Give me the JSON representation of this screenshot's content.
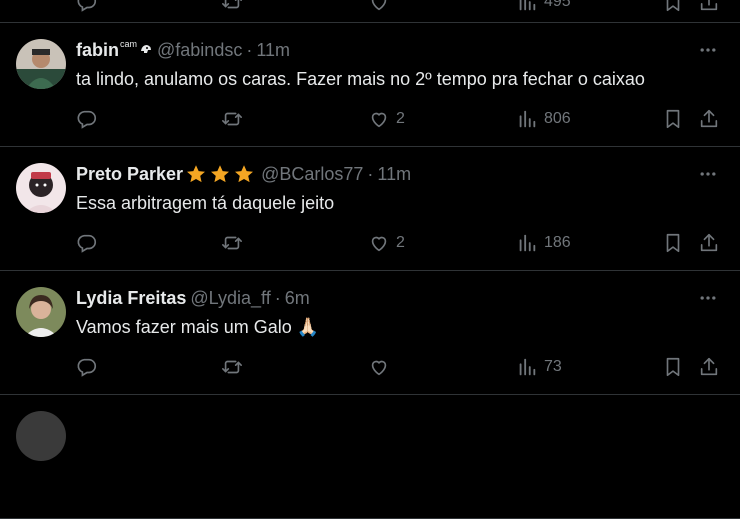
{
  "top_partial": {
    "views_count": "495"
  },
  "tweets": [
    {
      "name": "fabin",
      "badge": "cam",
      "handle": "@fabindsc",
      "dot": "·",
      "time": "11m",
      "text": "ta lindo, anulamo os caras. Fazer mais no 2º tempo pra fechar o caixao",
      "reply_count": "",
      "retweet_count": "",
      "like_count": "2",
      "view_count": "806"
    },
    {
      "name": "Preto Parker",
      "handle": "@BCarlos77",
      "dot": "·",
      "time": "11m",
      "text": "Essa arbitragem tá daquele jeito",
      "reply_count": "",
      "retweet_count": "",
      "like_count": "2",
      "view_count": "186"
    },
    {
      "name": "Lydia Freitas",
      "handle": "@Lydia_ff",
      "dot": "·",
      "time": "6m",
      "text": "Vamos fazer mais um Galo",
      "emoji": "🙏🏻",
      "reply_count": "",
      "retweet_count": "",
      "like_count": "",
      "view_count": "73"
    }
  ],
  "icons": {
    "more": "more-icon",
    "reply": "reply-icon",
    "retweet": "retweet-icon",
    "like": "heart-icon",
    "views": "views-icon",
    "bookmark": "bookmark-icon",
    "share": "share-icon",
    "star": "star-icon"
  },
  "colors": {
    "background": "#000000",
    "text_primary": "#e7e9ea",
    "text_secondary": "#71767b",
    "divider": "#2f3336",
    "star": "#f4a623"
  }
}
